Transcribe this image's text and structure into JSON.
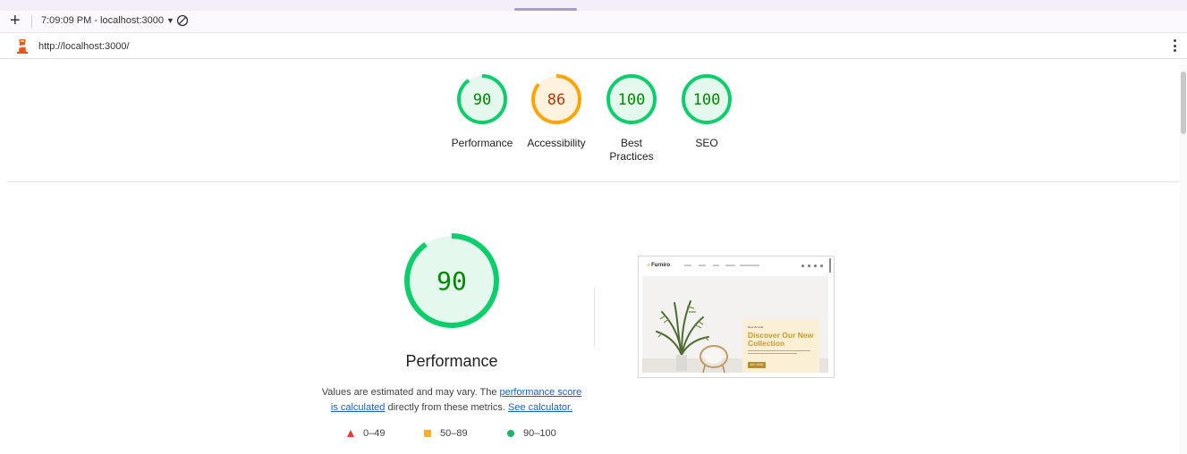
{
  "toolbar": {
    "new_label": "+",
    "report_select": "7:09:09 PM - localhost:3000",
    "report_select_caret": "▼"
  },
  "urlbar": {
    "url": "http://localhost:3000/"
  },
  "scores": [
    {
      "label": "Performance",
      "value": "90",
      "score": 0.9,
      "color": "#0cce6b",
      "fill": "#e5f8ee",
      "text_color": "#008800"
    },
    {
      "label": "Accessibility",
      "value": "86",
      "score": 0.86,
      "color": "#ffa400",
      "fill": "#fff3e0",
      "text_color": "#c33300"
    },
    {
      "label": "Best Practices",
      "value": "100",
      "score": 1.0,
      "color": "#0cce6b",
      "fill": "#e5f8ee",
      "text_color": "#008800"
    },
    {
      "label": "SEO",
      "value": "100",
      "score": 1.0,
      "color": "#0cce6b",
      "fill": "#e5f8ee",
      "text_color": "#008800"
    }
  ],
  "performance": {
    "value": "90",
    "score": 0.9,
    "title": "Performance",
    "desc_prefix": "Values are estimated and may vary. The ",
    "desc_link1": "performance score is calculated",
    "desc_middle": " directly from these metrics. ",
    "desc_link2": "See calculator."
  },
  "legend": [
    {
      "shape": "triangle",
      "range": "0–49",
      "color": "#e53935"
    },
    {
      "shape": "square",
      "range": "50–89",
      "color": "#fbae2d"
    },
    {
      "shape": "circle",
      "range": "90–100",
      "color": "#18b663"
    }
  ],
  "thumbnail": {
    "brand": "Furniro",
    "hero_kicker": "New Arrival",
    "hero_heading": "Discover Our New Collection",
    "hero_button": "BUY NOW"
  }
}
